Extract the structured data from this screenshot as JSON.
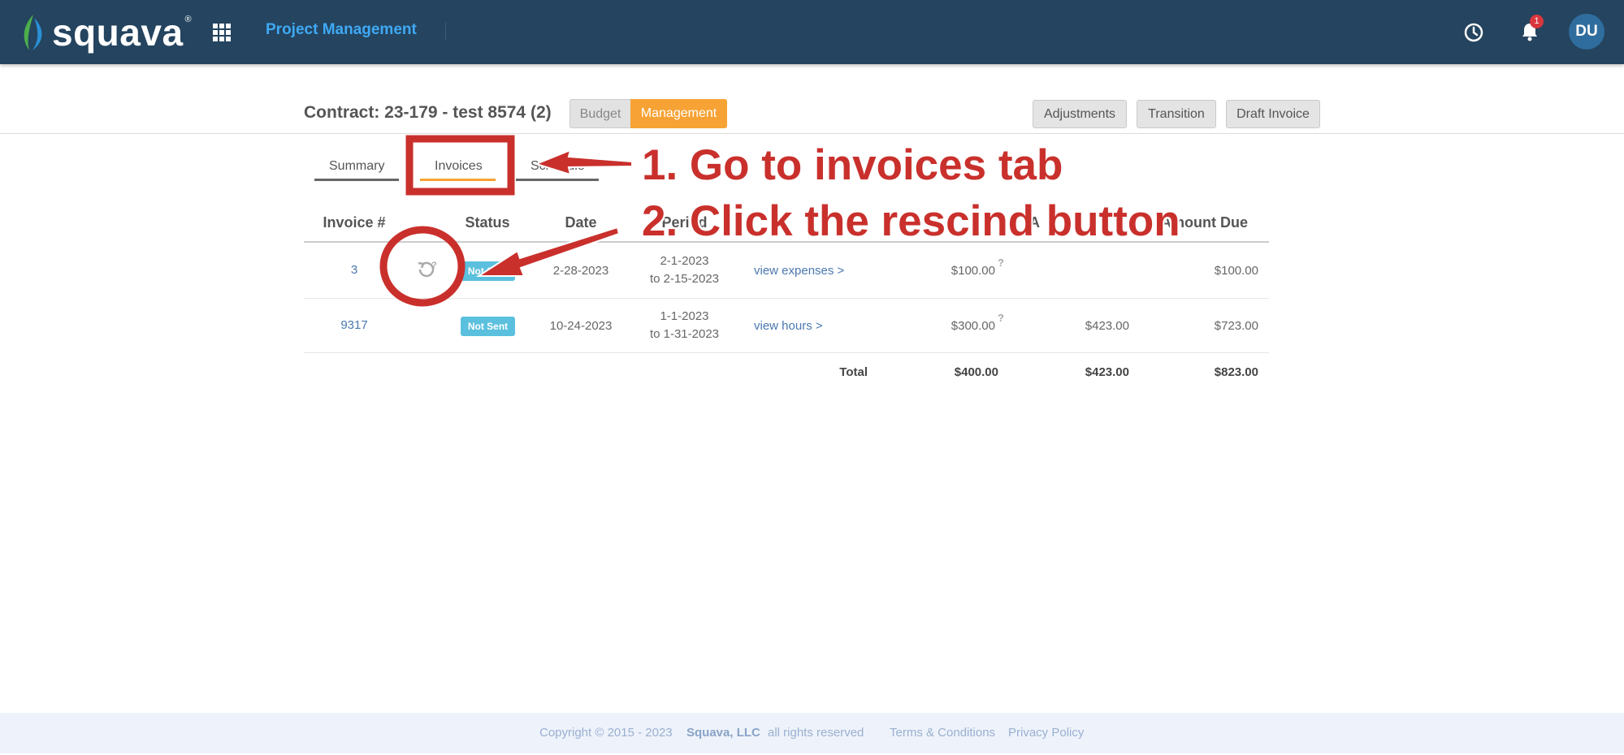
{
  "header": {
    "logo_text": "squava",
    "logo_reg": "®",
    "app_title": "Project Management",
    "notification_count": "1",
    "avatar_initials": "DU"
  },
  "contract": {
    "title": "Contract: 23-179 - test 8574 (2)",
    "segments": {
      "budget": "Budget",
      "management": "Management"
    },
    "buttons": {
      "adjustments": "Adjustments",
      "transition": "Transition",
      "draft_invoice": "Draft Invoice"
    }
  },
  "tabs": [
    {
      "label": "Summary",
      "active": false
    },
    {
      "label": "Invoices",
      "active": true
    },
    {
      "label": "Schedule",
      "active": false
    }
  ],
  "table": {
    "columns": [
      "Invoice #",
      "Status",
      "Date",
      "Period",
      "",
      "A",
      "Amount Due"
    ],
    "rows": [
      {
        "invoice": "3",
        "status": "Not Sent",
        "date": "2-28-2023",
        "period_start": "2-1-2023",
        "period_end": "to 2-15-2023",
        "view_link": "view expenses >",
        "amount": "$100.00",
        "help": "?",
        "adjustment": "",
        "amount_due": "$100.00"
      },
      {
        "invoice": "9317",
        "status": "Not Sent",
        "date": "10-24-2023",
        "period_start": "1-1-2023",
        "period_end": "to 1-31-2023",
        "view_link": "view hours >",
        "amount": "$300.00",
        "help": "?",
        "adjustment": "$423.00",
        "amount_due": "$723.00"
      }
    ],
    "total": {
      "label": "Total",
      "amount": "$400.00",
      "adjustment": "$423.00",
      "amount_due": "$823.00"
    }
  },
  "annotations": {
    "step1": "1. Go to invoices tab",
    "step2": "2. Click the rescind button",
    "color": "#c9302c"
  },
  "footer": {
    "copyright": "Copyright © 2015 - 2023",
    "company": "Squava, LLC",
    "rights": "all rights reserved",
    "terms": "Terms & Conditions",
    "privacy": "Privacy Policy"
  },
  "colors": {
    "header_bg": "#24445f",
    "app_title": "#3fa9f5",
    "management_accent": "#f7a234",
    "status_badge": "#5bc0de",
    "link": "#4a78b0"
  }
}
